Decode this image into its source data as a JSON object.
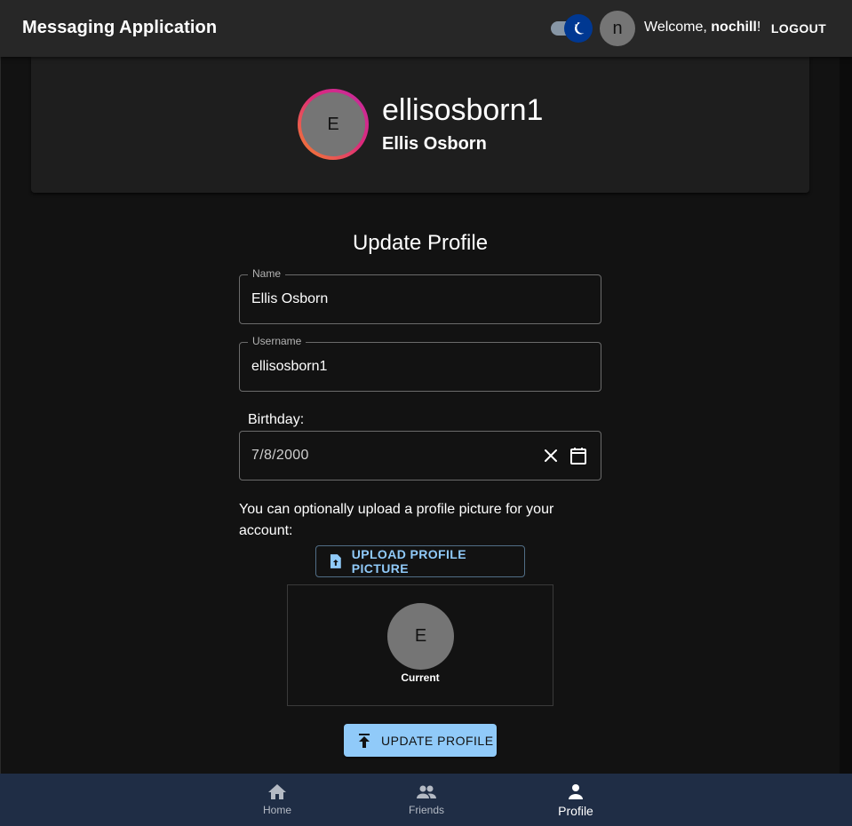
{
  "header": {
    "title": "Messaging Application",
    "avatar_letter": "n",
    "welcome_prefix": "Welcome, ",
    "welcome_user": "nochill",
    "welcome_suffix": "!",
    "logout_label": "LOGOUT"
  },
  "profile": {
    "avatar_letter": "E",
    "username": "ellisosborn1",
    "full_name": "Ellis Osborn"
  },
  "form": {
    "title": "Update Profile",
    "name_label": "Name",
    "name_value": "Ellis Osborn",
    "username_label": "Username",
    "username_value": "ellisosborn1",
    "birthday_label": "Birthday:",
    "birthday_value": "7/8/2000",
    "upload_text": "You can optionally upload a profile picture for your account:",
    "upload_button": "UPLOAD PROFILE PICTURE",
    "preview_letter": "E",
    "preview_caption": "Current",
    "update_button": "UPDATE PROFILE"
  },
  "bottom_nav": {
    "items": [
      {
        "label": "Home",
        "icon": "home-icon"
      },
      {
        "label": "Friends",
        "icon": "people-icon"
      },
      {
        "label": "Profile",
        "icon": "person-icon"
      }
    ],
    "active": "Profile"
  },
  "colors": {
    "accent": "#90caf9",
    "appbar": "#272727",
    "nav_bg": "#1f2d45",
    "background": "#121212"
  }
}
